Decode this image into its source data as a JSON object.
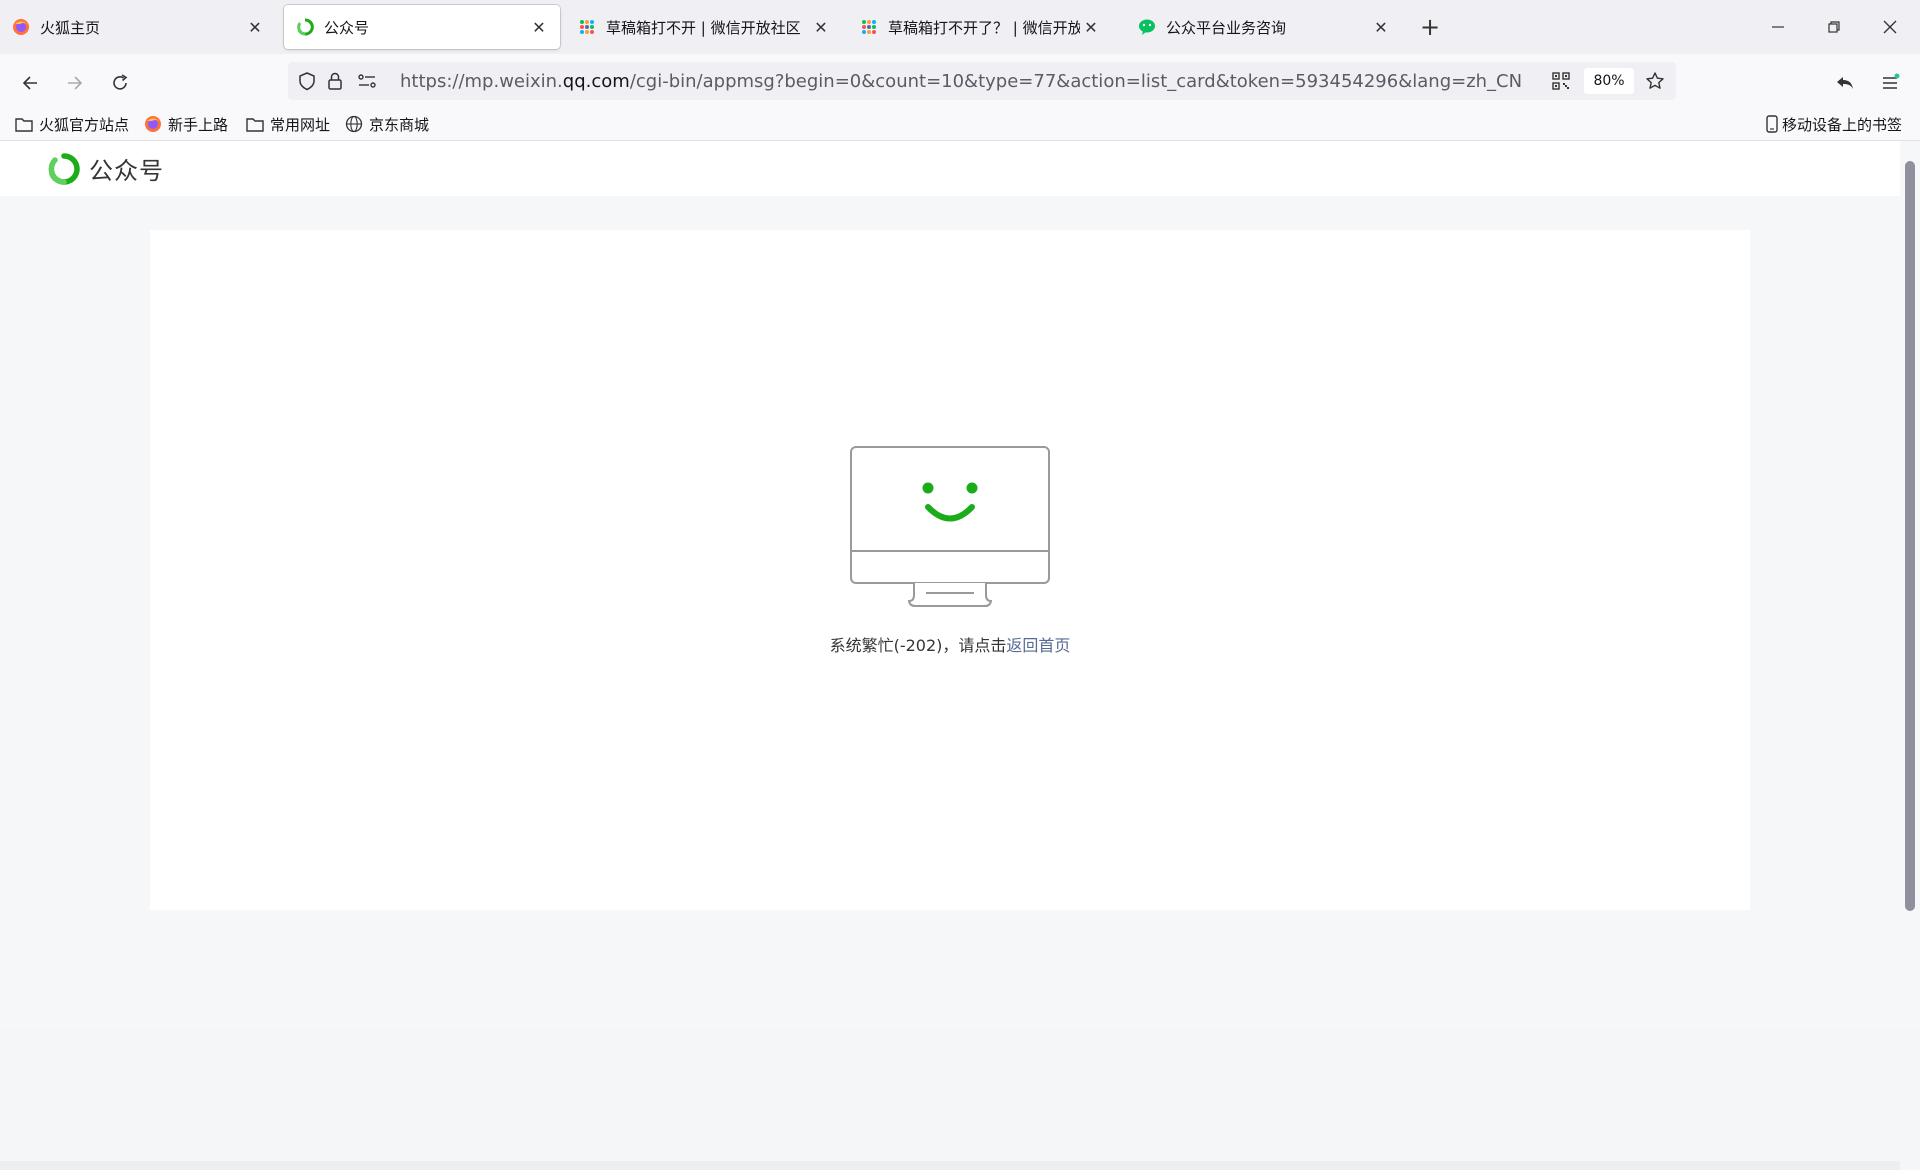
{
  "tabs": [
    {
      "title": "火狐主页",
      "icon": "firefox-icon"
    },
    {
      "title": "公众号",
      "icon": "weixin-mp-icon",
      "active": true
    },
    {
      "title": "草稿箱打不开 | 微信开放社区",
      "icon": "community-icon"
    },
    {
      "title": "草稿箱打不开了？ | 微信开放社",
      "icon": "community-icon"
    },
    {
      "title": "公众平台业务咨询",
      "icon": "wechat-icon"
    }
  ],
  "address": {
    "prefix": "https://mp.weixin.",
    "domain": "qq.com",
    "path": "/cgi-bin/appmsg?begin=0&count=10&type=77&action=list_card&token=593454296&lang=zh_CN",
    "zoom": "80%"
  },
  "bookmarks": [
    {
      "label": "火狐官方站点",
      "icon": "folder-icon"
    },
    {
      "label": "新手上路",
      "icon": "firefox-icon"
    },
    {
      "label": "常用网址",
      "icon": "folder-icon"
    },
    {
      "label": "京东商城",
      "icon": "globe-icon"
    }
  ],
  "mobile_bookmarks": "移动设备上的书签",
  "site": {
    "logo_text": "公众号"
  },
  "error": {
    "message": "系统繁忙(-202)，请点击",
    "link": "返回首页"
  },
  "colors": {
    "accent": "#1aad19",
    "link": "#576b95"
  }
}
